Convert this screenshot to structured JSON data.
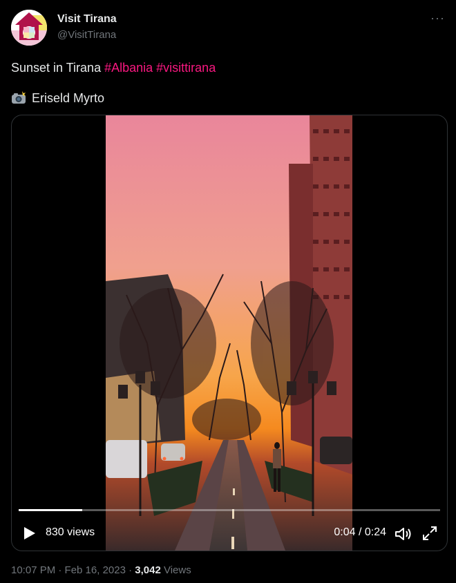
{
  "account": {
    "display_name": "Visit Tirana",
    "handle": "@VisitTirana"
  },
  "tweet": {
    "text": "Sunset in Tirana ",
    "hashtags": [
      "#Albania",
      "#visittirana"
    ],
    "credit_icon": "camera-flash-icon",
    "credit": "Eriseld Myrto"
  },
  "video": {
    "views": "830 views",
    "current_time": "0:04",
    "separator": " / ",
    "duration": "0:24",
    "progress": 0.15
  },
  "footer": {
    "time_date": "10:07 PM · Feb 16, 2023 · ",
    "view_count": "3,042",
    "views_label": " Views"
  },
  "colors": {
    "background": "#000000",
    "hashtag": "#f91880",
    "secondary_text": "#71767b",
    "border": "#2f3336"
  }
}
